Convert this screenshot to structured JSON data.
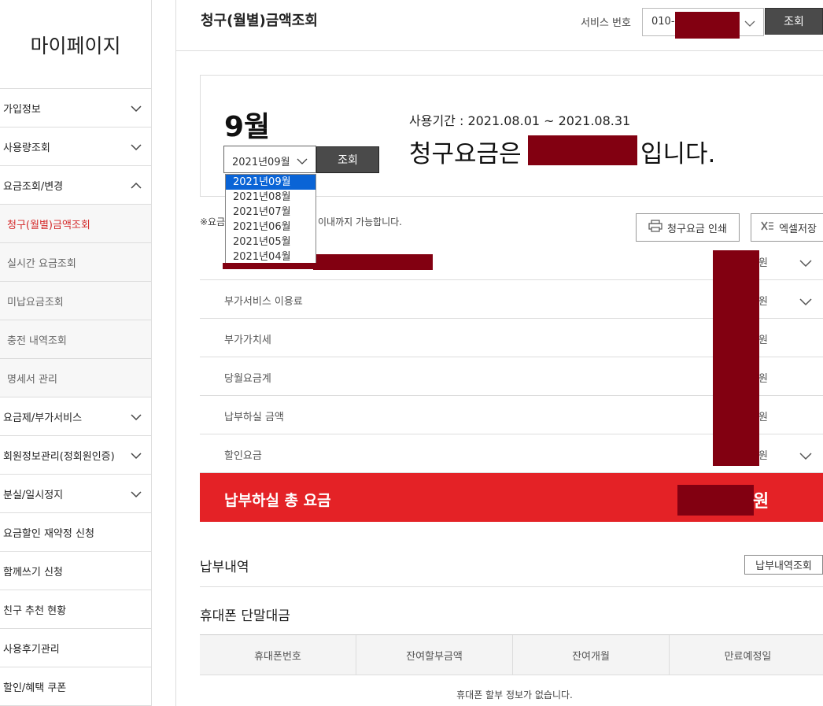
{
  "sidebar": {
    "title": "마이페이지",
    "items": [
      {
        "label": "가입정보"
      },
      {
        "label": "사용량조회"
      },
      {
        "label": "요금조회/변경"
      },
      {
        "label": "청구(월별)금액조회"
      },
      {
        "label": "실시간 요금조회"
      },
      {
        "label": "미납요금조회"
      },
      {
        "label": "충전 내역조회"
      },
      {
        "label": "명세서 관리"
      },
      {
        "label": "요금제/부가서비스"
      },
      {
        "label": "회원정보관리(정회원인증)"
      },
      {
        "label": "분실/일시정지"
      },
      {
        "label": "요금할인 재약정 신청"
      },
      {
        "label": "함께쓰기 신청"
      },
      {
        "label": "친구 추천 현황"
      },
      {
        "label": "사용후기관리"
      },
      {
        "label": "할인/혜택 쿠폰"
      }
    ]
  },
  "header": {
    "title": "청구(월별)금액조회",
    "service_label": "서비스 번호",
    "service_value": "010-",
    "search_button": "조회"
  },
  "summary": {
    "month": "9월",
    "selected_month": "2021년09월",
    "search_button": "조회",
    "period": "사용기간 : 2021.08.01 ~ 2021.08.31",
    "bill_prefix": "청구요금은",
    "bill_suffix": "입니다."
  },
  "month_options": [
    "2021년09월",
    "2021년08월",
    "2021년07월",
    "2021년06월",
    "2021년05월",
    "2021년04월"
  ],
  "note_prefix": "※요금",
  "note_suffix": "이내까지 가능합니다.",
  "actions": {
    "print": "청구요금 인쇄",
    "excel": "엑셀저장"
  },
  "bill_rows": [
    {
      "label": "",
      "unit": "원"
    },
    {
      "label": "부가서비스 이용료",
      "unit": "원"
    },
    {
      "label": "부가가치세",
      "unit": "원"
    },
    {
      "label": "당월요금계",
      "unit": "원"
    },
    {
      "label": "납부하실 금액",
      "unit": "원"
    },
    {
      "label": "할인요금",
      "unit": "원"
    }
  ],
  "total": {
    "label": "납부하실 총 요금",
    "unit": "원"
  },
  "payment": {
    "title": "납부내역",
    "button": "납부내역조회"
  },
  "device": {
    "title": "휴대폰 단말대금",
    "headers": [
      "휴대폰번호",
      "잔여할부금액",
      "잔여개월",
      "만료예정일"
    ],
    "empty": "휴대폰 할부 정보가 없습니다."
  },
  "colors": {
    "accent_red": "#e42226",
    "active_text": "#d42a2a",
    "redaction": "#820011",
    "dark_button": "#4a4a4a",
    "selected_option": "#0a64d6"
  }
}
